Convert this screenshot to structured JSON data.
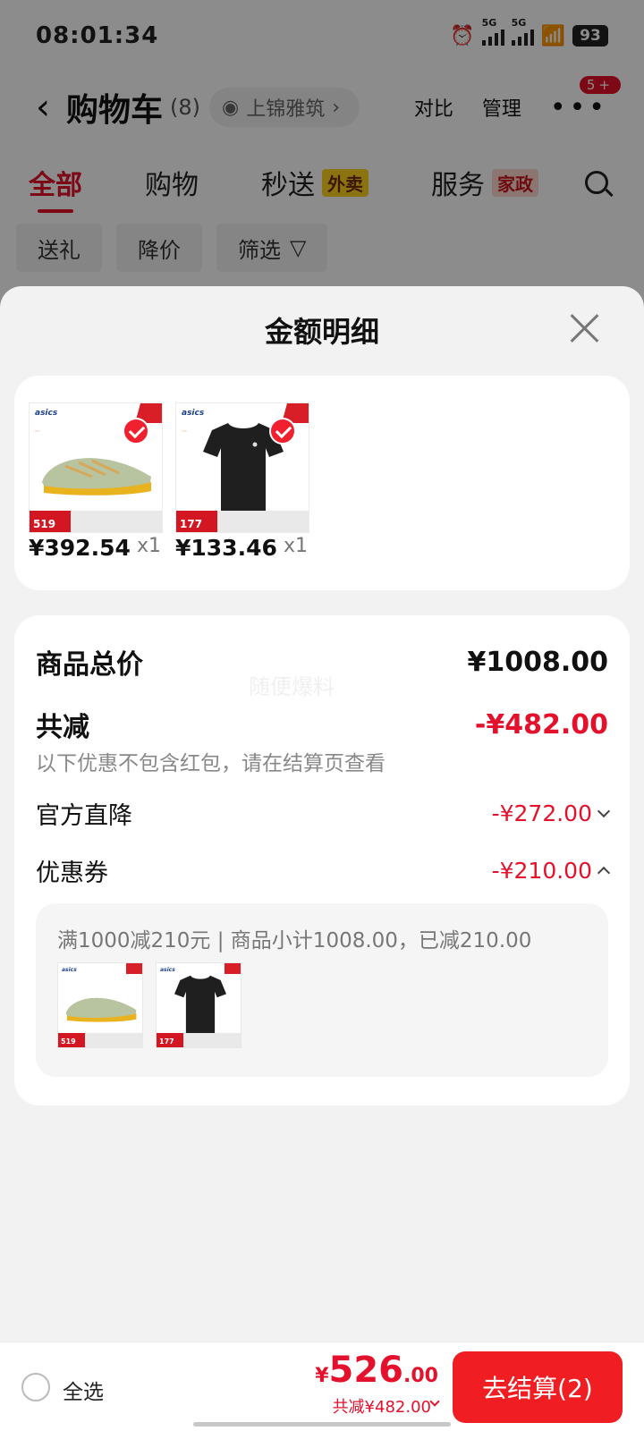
{
  "status_bar": {
    "time": "08:01:34",
    "net1": "5G",
    "net2": "5G",
    "battery": "93"
  },
  "header": {
    "title": "购物车",
    "count": "(8)",
    "address": "上锦雅筑",
    "compare": "对比",
    "manage": "管理",
    "more_badge": "5+"
  },
  "tabs": [
    {
      "label": "全部",
      "active": true
    },
    {
      "label": "购物"
    },
    {
      "label": "秒送",
      "tag": "外卖"
    },
    {
      "label": "服务",
      "tag": "家政"
    }
  ],
  "chips": [
    "送礼",
    "降价",
    "筛选"
  ],
  "sheet": {
    "title": "金额明细",
    "items": [
      {
        "price": "¥392.54",
        "qty": "x1",
        "thumb_brand": "asics",
        "thumb_price": "519"
      },
      {
        "price": "¥133.46",
        "qty": "x1",
        "thumb_brand": "asics",
        "thumb_price": "177"
      }
    ],
    "subtotal_label": "商品总价",
    "subtotal_value": "¥1008.00",
    "watermark": "随便爆料",
    "discount_label": "共减",
    "discount_value": "-¥482.00",
    "discount_hint": "以下优惠不包含红包，请在结算页查看",
    "official_label": "官方直降",
    "official_value": "-¥272.00",
    "coupon_label": "优惠券",
    "coupon_value": "-¥210.00",
    "coupon_detail": "满1000减210元 | 商品小计1008.00，已减210.00"
  },
  "bottom": {
    "select_all": "全选",
    "currency": "¥",
    "total_int": "526",
    "total_dec": ".00",
    "saved": "共减¥482.00",
    "checkout": "去结算(2)"
  },
  "colors": {
    "accent": "#e3112b",
    "checkout": "#f01d22"
  }
}
